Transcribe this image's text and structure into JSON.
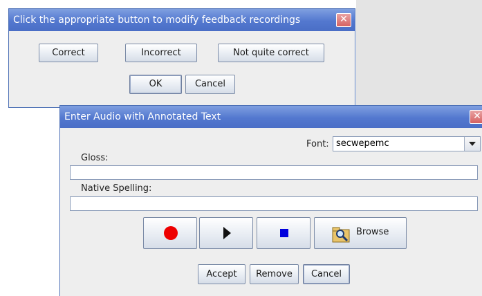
{
  "dialog1": {
    "title": "Click the appropriate button to modify feedback recordings",
    "close_symbol": "✕",
    "buttons": {
      "correct": "Correct",
      "incorrect": "Incorrect",
      "not_quite": "Not quite correct",
      "ok": "OK",
      "cancel": "Cancel"
    }
  },
  "dialog2": {
    "title": "Enter Audio with Annotated Text",
    "close_symbol": "✕",
    "font_label": "Font:",
    "font_value": "secwepemc",
    "gloss_label": "Gloss:",
    "gloss_value": "",
    "native_label": "Native Spelling:",
    "native_value": "",
    "media": {
      "record_icon": "record-icon",
      "play_icon": "play-icon",
      "stop_icon": "stop-icon",
      "browse_icon": "folder-search-icon",
      "browse_label": "Browse",
      "record_color": "#ee0000",
      "stop_color": "#0000dd"
    },
    "buttons": {
      "accept": "Accept",
      "remove": "Remove",
      "cancel": "Cancel"
    }
  },
  "colors": {
    "titlebar": "#5378cf",
    "window_bg": "#eeeeee"
  }
}
